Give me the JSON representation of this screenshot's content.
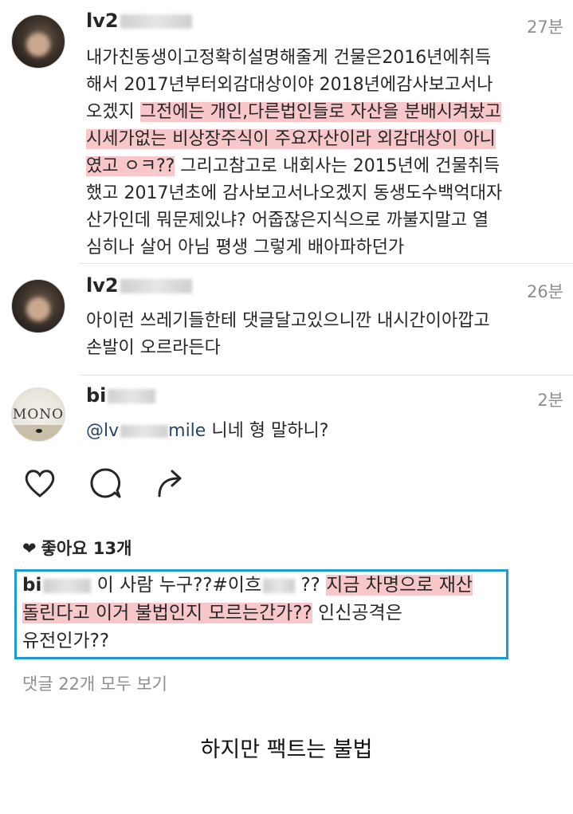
{
  "comments": [
    {
      "username_visible": "lv2",
      "time": "27분",
      "lines": [
        [
          {
            "t": "내가친동생이고정확히설명해줄게 건물은2016년에취득"
          }
        ],
        [
          {
            "t": "해서 2017년부터외감대상이야 2018년에감사보고서나"
          }
        ],
        [
          {
            "t": "오겠지 "
          },
          {
            "t": "그전에는 개인,다른법인들로 자산을 분배시켜놨고",
            "h": true
          }
        ],
        [
          {
            "t": "시세가없는  비상장주식이 주요자산이라 외감대상이 아니",
            "h": true
          }
        ],
        [
          {
            "t": "였고 ㅇㅋ??",
            "h": true
          },
          {
            "t": " 그리고참고로 내회사는 2015년에 건물취득"
          }
        ],
        [
          {
            "t": "했고 2017년초에 감사보고서나오겠지 동생도수백억대자"
          }
        ],
        [
          {
            "t": "산가인데 뭐문제있냐? 어줍잖은지식으로 까불지말고 열"
          }
        ],
        [
          {
            "t": "심히나 살어 아님 평생 그렇게 배아파하던가"
          }
        ]
      ]
    },
    {
      "username_visible": "lv2",
      "time": "26분",
      "lines": [
        [
          {
            "t": "아이런 쓰레기들한테 댓글달고있으니깐 내시간이아깝고"
          }
        ],
        [
          {
            "t": "손발이 오르라든다"
          }
        ]
      ]
    },
    {
      "username_visible": "bi",
      "time": "2분",
      "avatar_text": "MONO",
      "mention_prefix": "@lv",
      "mention_suffix": "mile",
      "rest": " 니네 형 말하니?"
    }
  ],
  "actions": {
    "like_icon": "heart-outline-icon",
    "comment_icon": "comment-bubble-icon",
    "share_icon": "share-arrow-icon"
  },
  "likes": {
    "heart": "❤",
    "label": "좋아요 13개"
  },
  "caption": {
    "username_visible": "bi",
    "part1": " 이 사람 누구??#이흐",
    "part2": " ?? ",
    "highlight1": "지금 차명으로 재산",
    "highlight2": "돌린다고 이거 불법인지 모르는간가??",
    "part3": " 인신공격은",
    "line3": "유전인가??"
  },
  "view_all": "댓글 22개 모두 보기",
  "bottom_note": "하지만 팩트는 불법",
  "colors": {
    "highlight": "#f7c7c9",
    "box_border": "#1e9ad6",
    "muted": "#8e8e8e"
  }
}
